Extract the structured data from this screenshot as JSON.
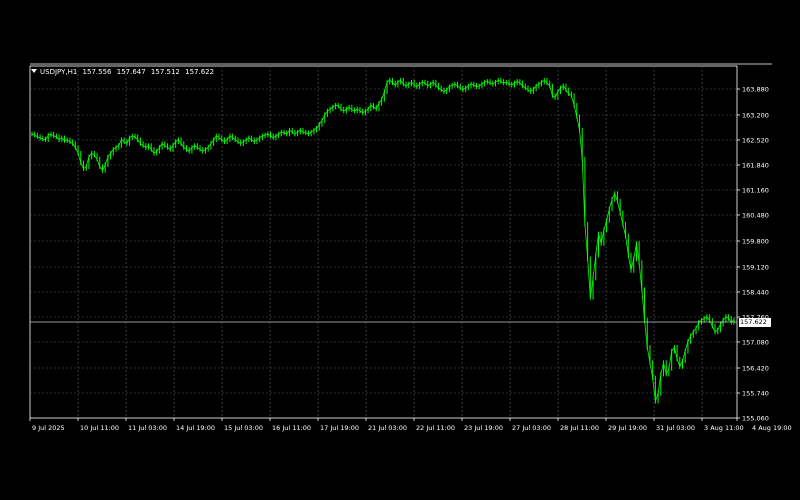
{
  "header": {
    "symbol": "USDJPY,H1",
    "open": "157.556",
    "high": "157.647",
    "low": "157.512",
    "close": "157.622",
    "menu_icon": "triangle-down-icon"
  },
  "current_price": "157.622",
  "colors": {
    "background": "#000000",
    "grid": "#5a5a5a",
    "candle": "#00ff00",
    "text": "#ffffff",
    "price_line": "#c8c8c8"
  },
  "chart_data": {
    "type": "line",
    "title": "USDJPY,H1",
    "xlabel": "",
    "ylabel": "",
    "ylim": [
      155.06,
      164.22
    ],
    "y_ticks": [
      "163.880",
      "163.200",
      "162.520",
      "161.840",
      "161.160",
      "160.480",
      "159.800",
      "159.120",
      "158.440",
      "157.760",
      "157.080",
      "156.420",
      "155.740",
      "155.060"
    ],
    "x_ticks": [
      "9 Jul 2025",
      "10 Jul 11:00",
      "11 Jul 03:00",
      "14 Jul 19:00",
      "15 Jul 03:00",
      "16 Jul 11:00",
      "17 Jul 19:00",
      "21 Jul 03:00",
      "22 Jul 11:00",
      "23 Jul 19:00",
      "27 Jul 03:00",
      "28 Jul 11:00",
      "29 Jul 19:00",
      "31 Jul 03:00",
      "3 Aug 11:00",
      "4 Aug 19:00"
    ],
    "grid": true,
    "series": [
      {
        "values": [
          162.45,
          162.42,
          162.38,
          162.35,
          162.32,
          162.3,
          162.42,
          162.45,
          162.4,
          162.38,
          162.3,
          162.35,
          162.28,
          162.3,
          162.25,
          162.2,
          162.1,
          161.95,
          161.7,
          161.55,
          161.6,
          161.85,
          161.95,
          161.9,
          161.8,
          161.6,
          161.5,
          161.65,
          161.85,
          161.95,
          162.05,
          162.1,
          162.15,
          162.3,
          162.25,
          162.2,
          162.35,
          162.4,
          162.38,
          162.3,
          162.2,
          162.15,
          162.1,
          162.15,
          162.05,
          161.95,
          162.0,
          162.1,
          162.2,
          162.15,
          162.1,
          162.05,
          162.15,
          162.25,
          162.3,
          162.2,
          162.1,
          162.05,
          162.0,
          162.1,
          162.15,
          162.1,
          162.05,
          162.0,
          162.05,
          162.1,
          162.2,
          162.3,
          162.4,
          162.35,
          162.3,
          162.25,
          162.3,
          162.4,
          162.35,
          162.3,
          162.25,
          162.2,
          162.25,
          162.3,
          162.35,
          162.3,
          162.25,
          162.3,
          162.35,
          162.4,
          162.42,
          162.45,
          162.4,
          162.35,
          162.4,
          162.45,
          162.5,
          162.48,
          162.45,
          162.55,
          162.5,
          162.45,
          162.5,
          162.55,
          162.5,
          162.48,
          162.45,
          162.5,
          162.55,
          162.6,
          162.7,
          162.8,
          162.95,
          163.05,
          163.1,
          163.15,
          163.2,
          163.18,
          163.1,
          163.05,
          163.1,
          163.15,
          163.08,
          163.05,
          163.1,
          163.05,
          163.0,
          163.05,
          163.1,
          163.2,
          163.15,
          163.1,
          163.25,
          163.35,
          163.55,
          163.8,
          163.85,
          163.78,
          163.72,
          163.8,
          163.85,
          163.75,
          163.7,
          163.75,
          163.8,
          163.72,
          163.68,
          163.75,
          163.8,
          163.78,
          163.7,
          163.75,
          163.8,
          163.72,
          163.65,
          163.6,
          163.55,
          163.6,
          163.68,
          163.72,
          163.75,
          163.7,
          163.65,
          163.6,
          163.65,
          163.7,
          163.75,
          163.72,
          163.68,
          163.7,
          163.75,
          163.8,
          163.82,
          163.78,
          163.75,
          163.8,
          163.85,
          163.82,
          163.78,
          163.8,
          163.75,
          163.72,
          163.78,
          163.82,
          163.78,
          163.7,
          163.65,
          163.6,
          163.55,
          163.62,
          163.7,
          163.75,
          163.8,
          163.85,
          163.78,
          163.7,
          163.45,
          163.4,
          163.55,
          163.65,
          163.7,
          163.6,
          163.5,
          163.45,
          163.2,
          162.9,
          162.55,
          161.8,
          160.1,
          159.2,
          158.2,
          158.7,
          159.3,
          159.85,
          159.6,
          159.95,
          160.2,
          160.5,
          160.75,
          160.9,
          160.7,
          160.4,
          160.1,
          159.8,
          159.3,
          158.9,
          159.2,
          159.6,
          159.1,
          158.4,
          157.6,
          156.9,
          156.5,
          156.1,
          155.5,
          155.7,
          156.2,
          156.5,
          156.2,
          156.35,
          156.8,
          156.9,
          156.6,
          156.4,
          156.55,
          156.8,
          157.05,
          157.2,
          157.3,
          157.4,
          157.55,
          157.6,
          157.65,
          157.7,
          157.6,
          157.45,
          157.3,
          157.35,
          157.5,
          157.6,
          157.7,
          157.65,
          157.55,
          157.62
        ]
      }
    ]
  }
}
